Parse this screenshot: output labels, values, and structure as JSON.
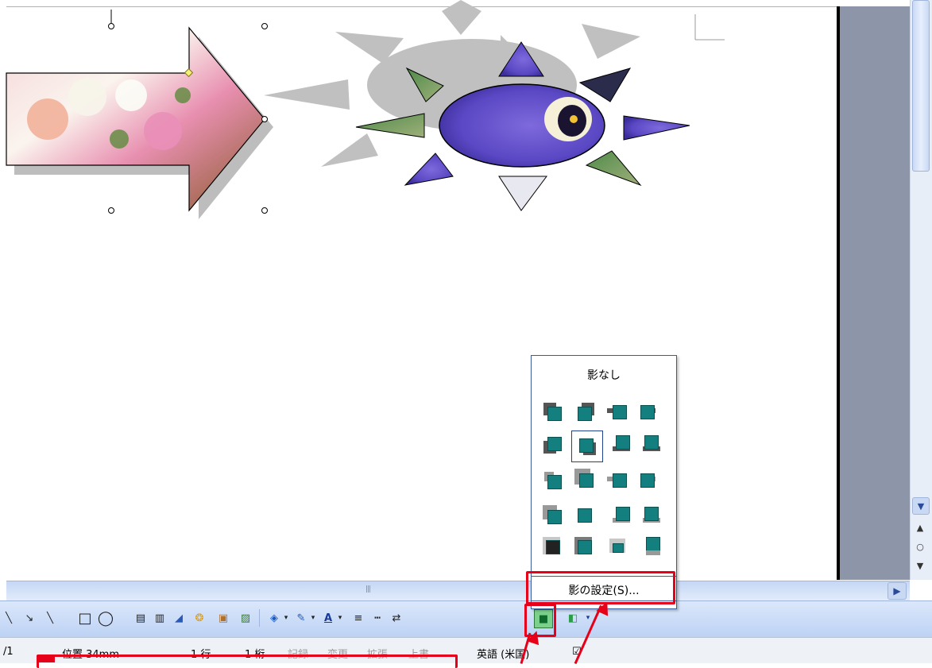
{
  "menu": {
    "no_shadow": "影なし",
    "settings": "影の設定(S)..."
  },
  "status": {
    "page": "/1",
    "position": "位置 34mm",
    "line": "1 行",
    "column": "1 桁",
    "rec": "記録",
    "trk": "変更",
    "ext": "拡張",
    "ovr": "上書",
    "lang": "英語 (米国)"
  },
  "colors": {
    "highlight": "#e6001a",
    "shadow_face": "#137f7e",
    "sun_rays": "#c0c0c0"
  },
  "icons": {
    "shadow_style": "shadow-style-icon",
    "three_d_style": "3d-style-icon"
  }
}
